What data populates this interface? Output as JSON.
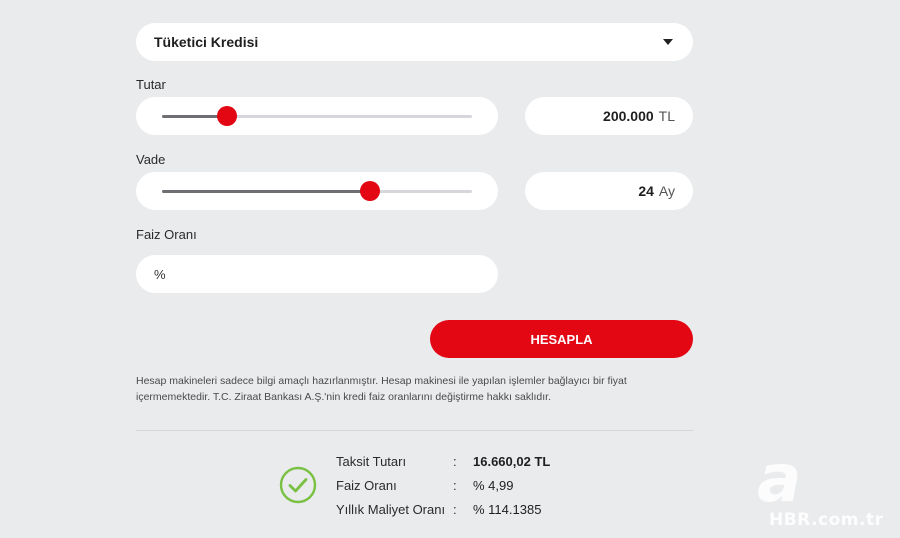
{
  "loan_type": {
    "selected": "Tüketici Kredisi"
  },
  "amount": {
    "label": "Tutar",
    "value": "200.000",
    "unit": "TL",
    "slider_level": 0.21
  },
  "term": {
    "label": "Vade",
    "value": "24",
    "unit": "Ay",
    "slider_level": 0.67
  },
  "interest": {
    "label": "Faiz Oranı",
    "prefix": "%"
  },
  "calculate_button": "HESAPLA",
  "disclaimer": {
    "line1": "Hesap makineleri sadece bilgi amaçlı hazırlanmıştır. Hesap makinesi ile yapılan işlemler bağlayıcı bir fiyat",
    "line2": "içermemektedir. T.C. Ziraat Bankası A.Ş.'nin kredi faiz oranlarını değiştirme hakkı saklıdır."
  },
  "results": [
    {
      "label": "Taksit Tutarı",
      "colon": ":",
      "value": "16.660,02 TL"
    },
    {
      "label": "Faiz Oranı",
      "colon": ":",
      "value": "% 4,99"
    },
    {
      "label": "Yıllık Maliyet Oranı",
      "colon": ":",
      "value": "% 114.1385"
    }
  ],
  "watermark": {
    "logo": "a",
    "text": "HBR.com.tr"
  },
  "colors": {
    "accent": "#e30613",
    "success": "#7ac143",
    "background": "#e9ebed"
  },
  "icons": {
    "dropdown": "caret-down-icon",
    "success": "check-circle-icon"
  }
}
